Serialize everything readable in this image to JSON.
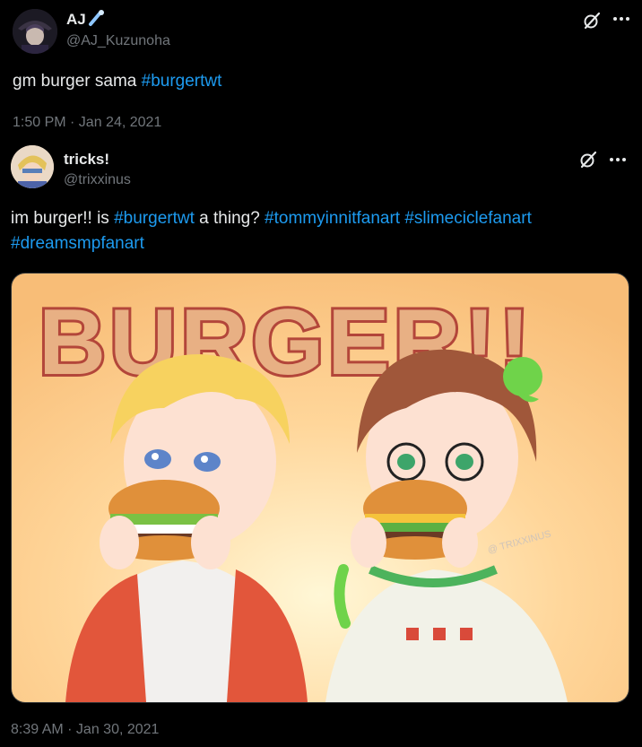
{
  "tweet1": {
    "name": "AJ",
    "handle": "@AJ_Kuzunoha",
    "text_plain": "gm burger sama ",
    "hashtag": "#burgertwt",
    "timestamp": "1:50 PM · Jan 24, 2021"
  },
  "tweet2": {
    "name": "tricks!",
    "handle": "@trixxinus",
    "text_parts": {
      "p1": "im burger!! is ",
      "h1": "#burgertwt",
      "p2": " a thing? ",
      "h2": "#tommyinnitfanart",
      "p3": " ",
      "h3": "#slimeciclefanart",
      "h4": "#dreamsmpfanart"
    },
    "image": {
      "title_art": "BURGER!!",
      "watermark": "@ TRIXXINUS"
    },
    "timestamp": "8:39 AM · Jan 30, 2021"
  },
  "icons": {
    "grok": "grok-icon",
    "more": "more-icon"
  }
}
